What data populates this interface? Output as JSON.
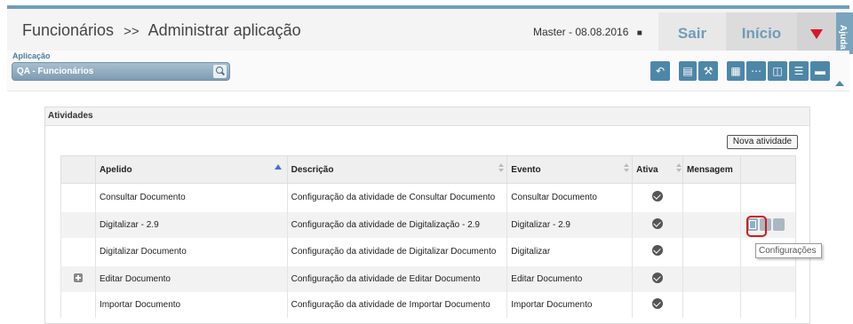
{
  "header": {
    "title_main": "Funcionários",
    "title_sep": ">>",
    "title_sub": "Administrar aplicação",
    "user": "Master - 08.08.2016",
    "sair": "Sair",
    "inicio": "Início",
    "ajuda": "Ajuda"
  },
  "app": {
    "label": "Aplicação",
    "selected": "QA - Funcionários"
  },
  "panel": {
    "title": "Atividades",
    "new_button": "Nova atividade"
  },
  "table": {
    "headers": {
      "apelido": "Apelido",
      "descricao": "Descrição",
      "evento": "Evento",
      "ativa": "Ativa",
      "mensagem": "Mensagem"
    },
    "rows": [
      {
        "apelido": "Consultar Documento",
        "descricao": "Configuração da atividade de Consultar Documento",
        "evento": "Consultar Documento"
      },
      {
        "apelido": "Digitalizar - 2.9",
        "descricao": "Configuração da atividade de Digitalização - 2.9",
        "evento": "Digitalizar - 2.9"
      },
      {
        "apelido": "Digitalizar Documento",
        "descricao": "Configuração da atividade de Digitalizar Documento",
        "evento": "Digitalizar"
      },
      {
        "apelido": "Editar Documento",
        "descricao": "Configuração da atividade de Editar Documento",
        "evento": "Editar Documento"
      },
      {
        "apelido": "Importar Documento",
        "descricao": "Configuração da atividade de Importar Documento",
        "evento": "Importar Documento"
      }
    ]
  },
  "tooltip": "Configurações",
  "colors": {
    "accent": "#4d87a8",
    "highlight": "#d21a1a",
    "menu_triangle": "#d6182a"
  }
}
